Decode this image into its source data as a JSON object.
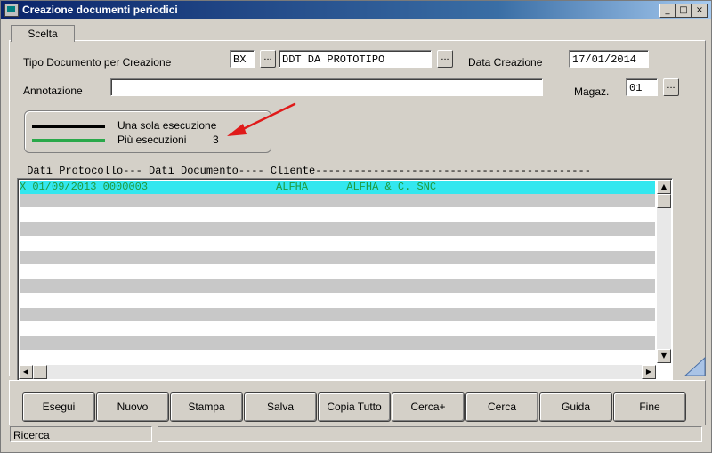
{
  "window": {
    "title": "Creazione documenti periodici"
  },
  "tabs": [
    {
      "label": "Scelta"
    }
  ],
  "form": {
    "tipo_label": "Tipo Documento per Creazione",
    "tipo_code": "BX",
    "tipo_desc": "DDT DA PROTOTIPO",
    "data_label": "Data Creazione",
    "data_value": "17/01/2014",
    "annotazione_label": "Annotazione",
    "annotazione_value": "",
    "magaz_label": "Magaz.",
    "magaz_value": "01",
    "ellipsis": "..."
  },
  "legend": {
    "single_label": "Una sola esecuzione",
    "multi_label": "Più esecuzioni",
    "multi_count": "3",
    "single_color": "#000000",
    "multi_color": "#2aa84a",
    "arrow_color": "#e01a1a"
  },
  "list": {
    "header": " Dati Protocollo--- Dati Documento---- Cliente-------------------------------------------",
    "rows": [
      {
        "text": "X 01/09/2013 0000003                    ALFHA      ALFHA & C. SNC",
        "selected": true
      }
    ],
    "selected_bg": "#33e7ef",
    "selected_fg": "#2aa84a"
  },
  "buttons": [
    {
      "label": "Esegui"
    },
    {
      "label": "Nuovo"
    },
    {
      "label": "Stampa"
    },
    {
      "label": "Salva"
    },
    {
      "label": "Copia Tutto"
    },
    {
      "label": "Cerca+"
    },
    {
      "label": "Cerca"
    },
    {
      "label": "Guida"
    },
    {
      "label": "Fine"
    }
  ],
  "status": {
    "left": "Ricerca",
    "right": ""
  }
}
